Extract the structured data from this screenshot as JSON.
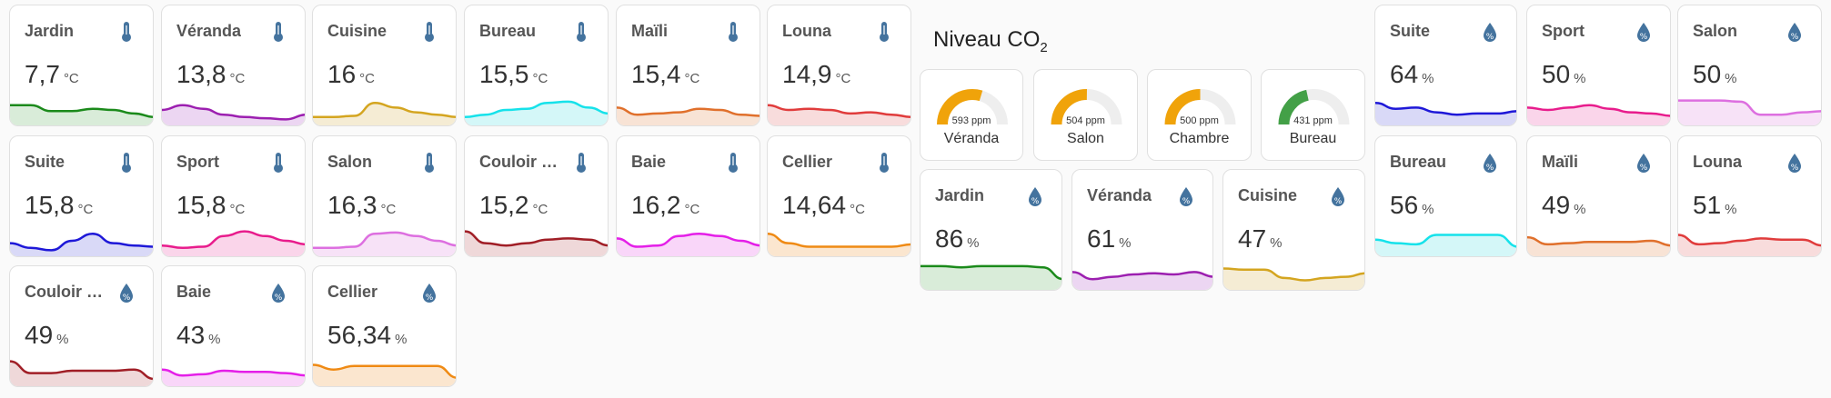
{
  "colors": {
    "icon": "#44739e",
    "gauge_track": "#eeeeee",
    "gauge_orange": "#f0a30a",
    "gauge_green": "#43a047"
  },
  "sensors": [
    {
      "name": "Jardin",
      "value": "7,7",
      "unit": "°C",
      "icon": "thermometer-icon",
      "color": "#1b8a1b",
      "fill": "#d9ecd9",
      "curve": [
        0.7,
        0.7,
        0.45,
        0.45,
        0.55,
        0.5,
        0.35,
        0.2
      ]
    },
    {
      "name": "Véranda",
      "value": "13,8",
      "unit": "°C",
      "icon": "thermometer-icon",
      "color": "#9c1fb0",
      "fill": "#ecd6f2",
      "curve": [
        0.5,
        0.7,
        0.55,
        0.3,
        0.2,
        0.15,
        0.1,
        0.3
      ]
    },
    {
      "name": "Cuisine",
      "value": "16",
      "unit": "°C",
      "icon": "thermometer-icon",
      "color": "#d4a520",
      "fill": "#f5ecd4",
      "curve": [
        0.2,
        0.2,
        0.25,
        0.8,
        0.6,
        0.4,
        0.3,
        0.2
      ]
    },
    {
      "name": "Bureau",
      "value": "15,5",
      "unit": "°C",
      "icon": "thermometer-icon",
      "color": "#16e2ea",
      "fill": "#d4f7f8",
      "curve": [
        0.2,
        0.3,
        0.5,
        0.55,
        0.8,
        0.85,
        0.6,
        0.35
      ]
    },
    {
      "name": "Maïli",
      "value": "15,4",
      "unit": "°C",
      "icon": "thermometer-icon",
      "color": "#e0702c",
      "fill": "#f8e3d5",
      "curve": [
        0.6,
        0.3,
        0.35,
        0.4,
        0.55,
        0.5,
        0.3,
        0.25
      ]
    },
    {
      "name": "Louna",
      "value": "14,9",
      "unit": "°C",
      "icon": "thermometer-icon",
      "color": "#e03c3c",
      "fill": "#f8dcdc",
      "curve": [
        0.7,
        0.5,
        0.55,
        0.5,
        0.35,
        0.4,
        0.3,
        0.2
      ]
    },
    {
      "name": "Suite",
      "value": "15,8",
      "unit": "°C",
      "icon": "thermometer-icon",
      "color": "#1e18d8",
      "fill": "#d9d9f7",
      "curve": [
        0.4,
        0.2,
        0.1,
        0.5,
        0.8,
        0.4,
        0.3,
        0.25
      ]
    },
    {
      "name": "Sport",
      "value": "15,8",
      "unit": "°C",
      "icon": "thermometer-icon",
      "color": "#e81c8c",
      "fill": "#fad5ea",
      "curve": [
        0.3,
        0.2,
        0.25,
        0.7,
        0.9,
        0.7,
        0.5,
        0.35
      ]
    },
    {
      "name": "Salon",
      "value": "16,3",
      "unit": "°C",
      "icon": "thermometer-icon",
      "color": "#dd6fe0",
      "fill": "#f7e2f7",
      "curve": [
        0.2,
        0.2,
        0.25,
        0.8,
        0.85,
        0.7,
        0.5,
        0.3
      ]
    },
    {
      "name": "Couloir Éta…",
      "value": "15,2",
      "unit": "°C",
      "icon": "thermometer-icon",
      "color": "#a01e26",
      "fill": "#efd8d9",
      "curve": [
        0.9,
        0.4,
        0.3,
        0.4,
        0.55,
        0.6,
        0.55,
        0.3
      ]
    },
    {
      "name": "Baie",
      "value": "16,2",
      "unit": "°C",
      "icon": "thermometer-icon",
      "color": "#e41fe8",
      "fill": "#f9d6f9",
      "curve": [
        0.6,
        0.25,
        0.3,
        0.7,
        0.8,
        0.7,
        0.5,
        0.3
      ]
    },
    {
      "name": "Cellier",
      "value": "14,64",
      "unit": "°C",
      "icon": "thermometer-icon",
      "color": "#ef8a14",
      "fill": "#fbe6cf",
      "curve": [
        0.8,
        0.4,
        0.25,
        0.25,
        0.25,
        0.25,
        0.25,
        0.35
      ]
    },
    {
      "name": "Couloir Éta…",
      "value": "49",
      "unit": "%",
      "icon": "water-percent-icon",
      "color": "#a01e26",
      "fill": "#efd8d9",
      "curve": [
        0.9,
        0.4,
        0.4,
        0.5,
        0.5,
        0.5,
        0.55,
        0.15
      ]
    },
    {
      "name": "Baie",
      "value": "43",
      "unit": "%",
      "icon": "water-percent-icon",
      "color": "#e41fe8",
      "fill": "#f9d6f9",
      "curve": [
        0.55,
        0.3,
        0.35,
        0.5,
        0.45,
        0.45,
        0.4,
        0.3
      ]
    },
    {
      "name": "Cellier",
      "value": "56,34",
      "unit": "%",
      "icon": "water-percent-icon",
      "color": "#ef8a14",
      "fill": "#fbe6cf",
      "curve": [
        0.75,
        0.55,
        0.7,
        0.7,
        0.7,
        0.7,
        0.7,
        0.2
      ]
    },
    {
      "name": "Jardin",
      "value": "86",
      "unit": "%",
      "icon": "water-percent-icon",
      "color": "#1b8a1b",
      "fill": "#d9ecd9",
      "curve": [
        0.85,
        0.85,
        0.8,
        0.85,
        0.85,
        0.85,
        0.8,
        0.3
      ]
    },
    {
      "name": "Véranda",
      "value": "61",
      "unit": "%",
      "icon": "water-percent-icon",
      "color": "#9c1fb0",
      "fill": "#ecd6f2",
      "curve": [
        0.6,
        0.3,
        0.4,
        0.5,
        0.55,
        0.5,
        0.6,
        0.4
      ]
    },
    {
      "name": "Cuisine",
      "value": "47",
      "unit": "%",
      "icon": "water-percent-icon",
      "color": "#d4a520",
      "fill": "#f5ecd4",
      "curve": [
        0.75,
        0.7,
        0.7,
        0.35,
        0.25,
        0.35,
        0.4,
        0.55
      ]
    },
    {
      "name": "Suite",
      "value": "64",
      "unit": "%",
      "icon": "water-percent-icon",
      "color": "#1e18d8",
      "fill": "#d9d9f7",
      "curve": [
        0.8,
        0.55,
        0.6,
        0.4,
        0.3,
        0.35,
        0.35,
        0.45
      ]
    },
    {
      "name": "Sport",
      "value": "50",
      "unit": "%",
      "icon": "water-percent-icon",
      "color": "#e81c8c",
      "fill": "#fad5ea",
      "curve": [
        0.6,
        0.5,
        0.6,
        0.7,
        0.55,
        0.4,
        0.35,
        0.25
      ]
    },
    {
      "name": "Salon",
      "value": "50",
      "unit": "%",
      "icon": "water-percent-icon",
      "color": "#dd6fe0",
      "fill": "#f7e2f7",
      "curve": [
        0.9,
        0.9,
        0.9,
        0.85,
        0.3,
        0.3,
        0.4,
        0.45
      ]
    },
    {
      "name": "Bureau",
      "value": "56",
      "unit": "%",
      "icon": "water-percent-icon",
      "color": "#16e2ea",
      "fill": "#d4f7f8",
      "curve": [
        0.55,
        0.4,
        0.35,
        0.75,
        0.75,
        0.75,
        0.75,
        0.25
      ]
    },
    {
      "name": "Maïli",
      "value": "49",
      "unit": "%",
      "icon": "water-percent-icon",
      "color": "#e0702c",
      "fill": "#f8e3d5",
      "curve": [
        0.65,
        0.35,
        0.4,
        0.45,
        0.45,
        0.45,
        0.5,
        0.3
      ]
    },
    {
      "name": "Louna",
      "value": "51",
      "unit": "%",
      "icon": "water-percent-icon",
      "color": "#e03c3c",
      "fill": "#f8dcdc",
      "curve": [
        0.75,
        0.35,
        0.4,
        0.5,
        0.6,
        0.55,
        0.55,
        0.3
      ]
    }
  ],
  "co2": {
    "title": "Niveau CO",
    "title_sub": "2",
    "max_ppm": 1000,
    "gauges": [
      {
        "label": "Véranda",
        "value": "593 ppm",
        "ppm": 593,
        "color": "#f0a30a"
      },
      {
        "label": "Salon",
        "value": "504 ppm",
        "ppm": 504,
        "color": "#f0a30a"
      },
      {
        "label": "Chambre",
        "value": "500 ppm",
        "ppm": 500,
        "color": "#f0a30a"
      },
      {
        "label": "Bureau",
        "value": "431 ppm",
        "ppm": 431,
        "color": "#43a047"
      }
    ]
  }
}
